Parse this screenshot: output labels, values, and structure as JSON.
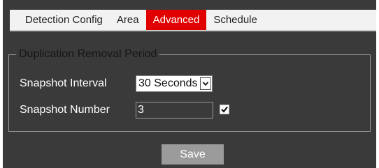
{
  "tabs": [
    {
      "label": "Detection Config",
      "active": false
    },
    {
      "label": "Area",
      "active": false
    },
    {
      "label": "Advanced",
      "active": true
    },
    {
      "label": "Schedule",
      "active": false
    }
  ],
  "section": {
    "legend": "Duplication Removal Period"
  },
  "snapshot_interval": {
    "label": "Snapshot Interval",
    "value": "30 Seconds"
  },
  "snapshot_number": {
    "label": "Snapshot Number",
    "value": "3",
    "checked": true
  },
  "save_button": {
    "label": "Save"
  },
  "colors": {
    "panel_bg": "#3a3a3a",
    "active_tab": "#e10000",
    "button_bg": "#9b9b9b"
  },
  "icons": {
    "dropdown": "chevron-down-icon",
    "checkbox": "checkmark-icon"
  }
}
